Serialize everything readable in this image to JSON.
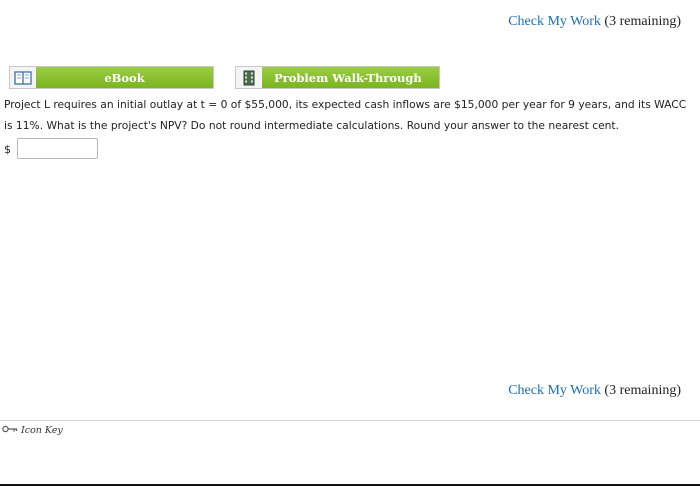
{
  "check_top": {
    "link": "Check My Work",
    "remaining": "(3 remaining)"
  },
  "resources": {
    "ebook": "eBook",
    "walkthrough": "Problem Walk-Through",
    "ebook_icon": "book-icon",
    "walkthrough_icon": "film-icon"
  },
  "question": {
    "text": "Project L requires an initial outlay at t = 0 of $55,000, its expected cash inflows are $15,000 per year for 9 years, and its WACC is 11%. What is the project's NPV? Do not round intermediate calculations. Round your answer to the nearest cent."
  },
  "answer": {
    "prefix": "$",
    "value": ""
  },
  "check_bottom": {
    "link": "Check My Work",
    "remaining": "(3 remaining)"
  },
  "footer": {
    "icon_key": "Icon Key",
    "icon": "key-icon"
  },
  "colors": {
    "link": "#1a6fb5",
    "button_green": "#8cc63f"
  }
}
